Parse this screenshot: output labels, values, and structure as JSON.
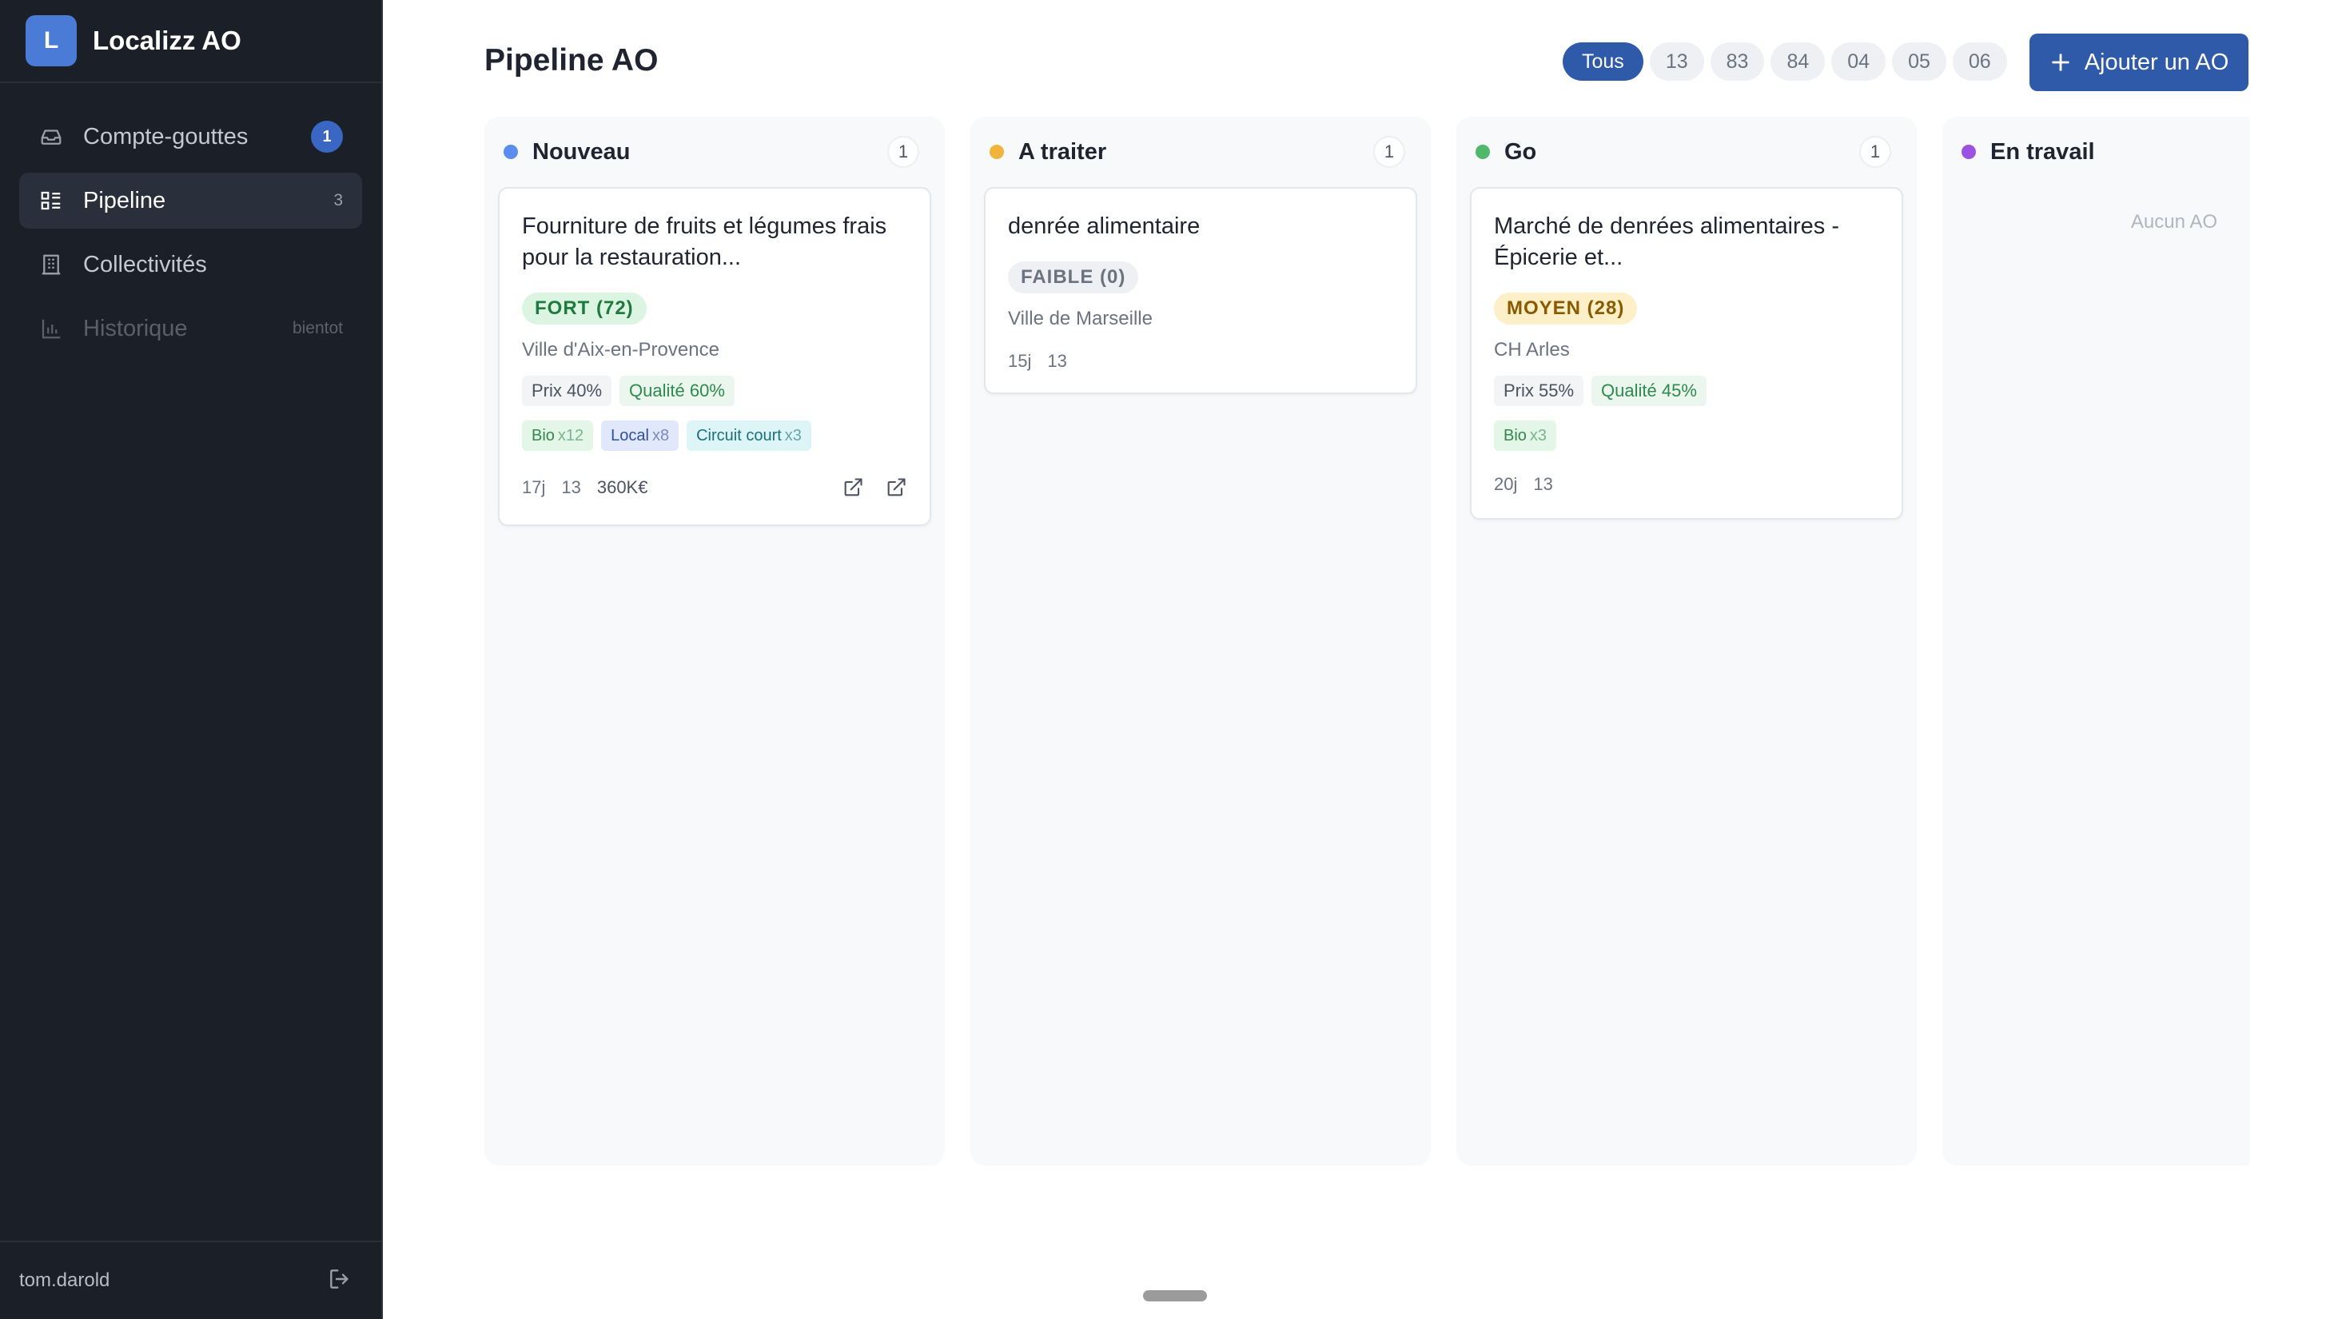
{
  "app": {
    "logo_letter": "L",
    "name": "Localizz AO"
  },
  "sidebar": {
    "items": [
      {
        "label": "Compte-gouttes",
        "badge": "1"
      },
      {
        "label": "Pipeline",
        "count": "3"
      },
      {
        "label": "Collectivités"
      },
      {
        "label": "Historique",
        "note": "bientot"
      }
    ],
    "user": "tom.darold"
  },
  "header": {
    "title": "Pipeline AO",
    "filters": [
      "Tous",
      "13",
      "83",
      "84",
      "04",
      "05",
      "06"
    ],
    "add_label": "Ajouter un AO"
  },
  "colors": {
    "accent": "#2f5aa9",
    "nouveau": "#5b8def",
    "a_traiter": "#f0b43c",
    "go": "#4fb86a",
    "en_travail": "#9b52e0"
  },
  "columns": [
    {
      "title": "Nouveau",
      "count": "1",
      "card": {
        "title": "Fourniture de fruits et légumes frais pour la restauration...",
        "score": "FORT (72)",
        "buyer": "Ville d'Aix-en-Provence",
        "prix": "Prix 40%",
        "qualite": "Qualité 60%",
        "tags": [
          {
            "label": "Bio",
            "mult": "x12"
          },
          {
            "label": "Local",
            "mult": "x8"
          },
          {
            "label": "Circuit court",
            "mult": "x3"
          }
        ],
        "days": "17j",
        "dept": "13",
        "amount": "360K€"
      }
    },
    {
      "title": "A traiter",
      "count": "1",
      "card": {
        "title": "denrée alimentaire",
        "score": "FAIBLE (0)",
        "buyer": "Ville de Marseille",
        "days": "15j",
        "dept": "13"
      }
    },
    {
      "title": "Go",
      "count": "1",
      "card": {
        "title": "Marché de denrées alimentaires - Épicerie et...",
        "score": "MOYEN (28)",
        "buyer": "CH Arles",
        "prix": "Prix 55%",
        "qualite": "Qualité 45%",
        "tags": [
          {
            "label": "Bio",
            "mult": "x3"
          }
        ],
        "days": "20j",
        "dept": "13"
      }
    },
    {
      "title": "En travail",
      "empty": "Aucun AO"
    }
  ]
}
